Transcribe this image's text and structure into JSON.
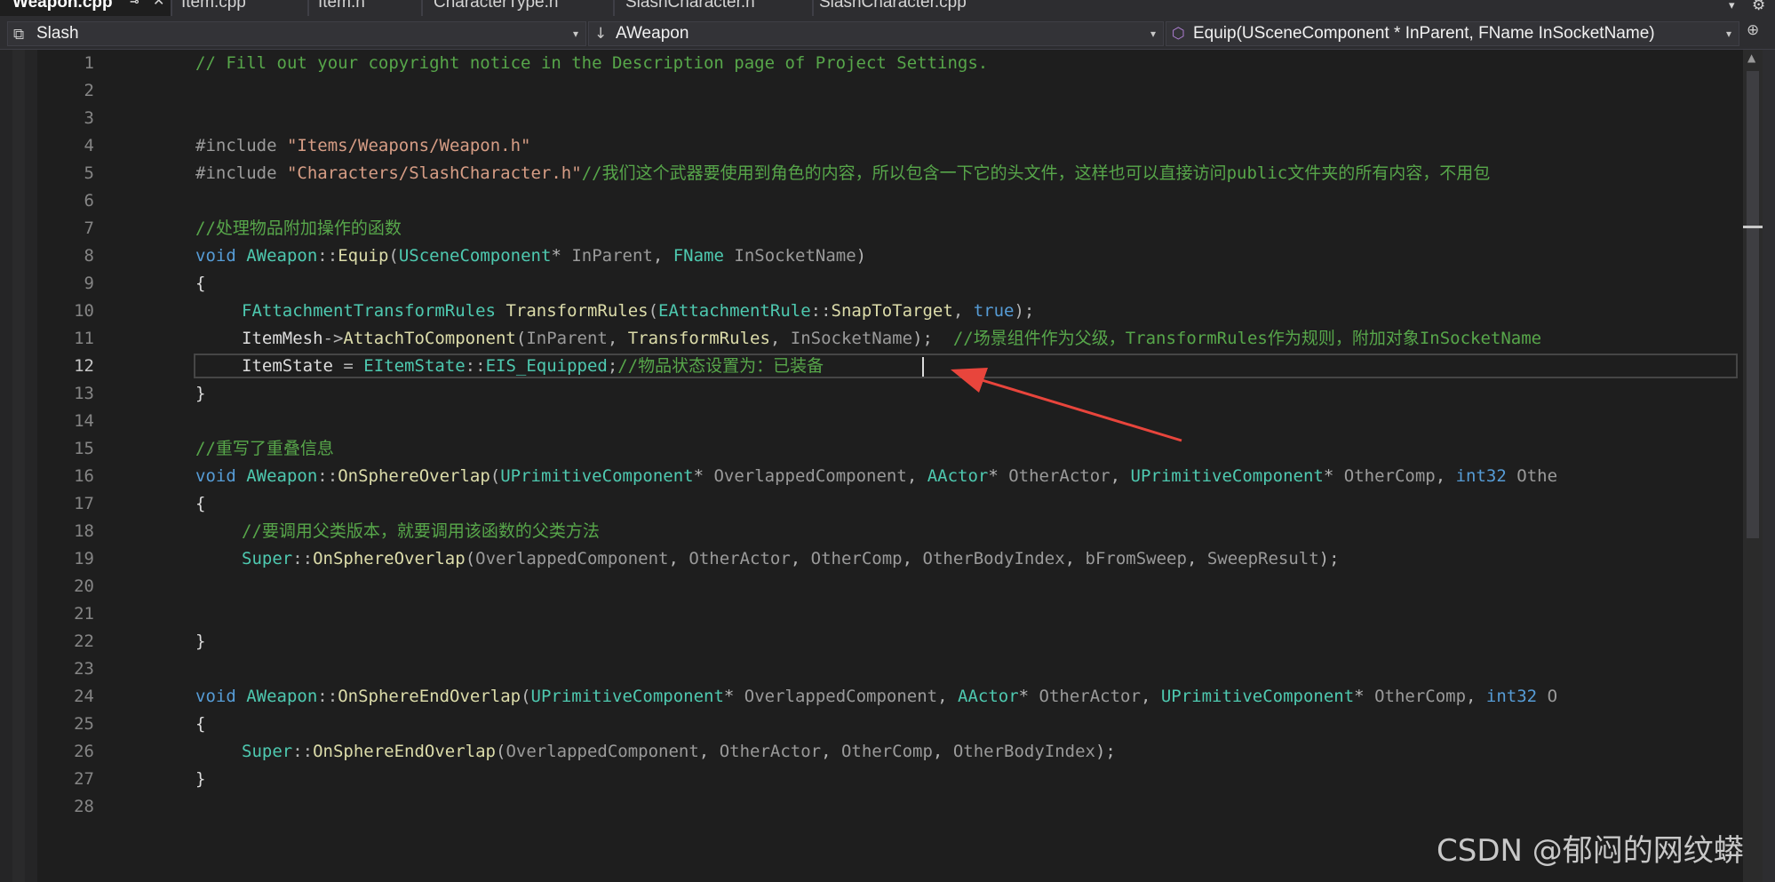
{
  "tabs": [
    {
      "label": "Weapon.cpp",
      "active": true
    },
    {
      "label": "Item.cpp"
    },
    {
      "label": "Item.h"
    },
    {
      "label": "CharacterType.h"
    },
    {
      "label": "SlashCharacter.h"
    },
    {
      "label": "SlashCharacter.cpp"
    }
  ],
  "tab_icons": {
    "pin": "pin-icon",
    "close": "✕",
    "overflow": "▾",
    "settings": "⚙"
  },
  "nav": {
    "project": "Slash",
    "scope": "AWeapon",
    "member": "Equip(USceneComponent * InParent, FName InSocketName)"
  },
  "line_numbers": [
    "1",
    "2",
    "3",
    "4",
    "5",
    "6",
    "7",
    "8",
    "9",
    "10",
    "11",
    "12",
    "13",
    "14",
    "15",
    "16",
    "17",
    "18",
    "19",
    "20",
    "21",
    "22",
    "23",
    "24",
    "25",
    "26",
    "27",
    "28"
  ],
  "current_line": "12",
  "code": {
    "l1": "// Fill out your copyright notice in the Description page of Project Settings.",
    "l4_dir": "#include ",
    "l4_str": "\"Items/Weapons/Weapon.h\"",
    "l5_dir": "#include ",
    "l5_str": "\"Characters/SlashCharacter.h\"",
    "l5_cm": "//我们这个武器要使用到角色的内容，所以包含一下它的头文件，这样也可以直接访问public文件夹的所有内容，不用包",
    "l7": "//处理物品附加操作的函数",
    "l8": [
      "void",
      "AWeapon",
      "::",
      "Equip",
      "(",
      "USceneComponent",
      "* ",
      "InParent",
      ", ",
      "FName",
      " ",
      "InSocketName",
      ")"
    ],
    "l9": "{",
    "l10": [
      "FAttachmentTransformRules",
      " ",
      "TransformRules",
      "(",
      "EAttachmentRule",
      "::",
      "SnapToTarget",
      ", ",
      "true",
      ");"
    ],
    "l11": [
      "ItemMesh",
      "->",
      "AttachToComponent",
      "(",
      "InParent",
      ", ",
      "TransformRules",
      ", ",
      "InSocketName",
      ");  ",
      "//场景组件作为父级，TransformRules作为规则，附加对象InSocketName"
    ],
    "l12": [
      "ItemState",
      " = ",
      "EItemState",
      "::",
      "EIS_Equipped",
      ";",
      "//物品状态设置为：已装备"
    ],
    "l13": "}",
    "l15": "//重写了重叠信息",
    "l16": [
      "void",
      "AWeapon",
      "::",
      "OnSphereOverlap",
      "(",
      "UPrimitiveComponent",
      "* ",
      "OverlappedComponent",
      ", ",
      "AActor",
      "* ",
      "OtherActor",
      ", ",
      "UPrimitiveComponent",
      "* ",
      "OtherComp",
      ", ",
      "int32",
      " ",
      "Othe"
    ],
    "l17": "{",
    "l18": "//要调用父类版本，就要调用该函数的父类方法",
    "l19": [
      "Super",
      "::",
      "OnSphereOverlap",
      "(",
      "OverlappedComponent",
      ", ",
      "OtherActor",
      ", ",
      "OtherComp",
      ", ",
      "OtherBodyIndex",
      ", ",
      "bFromSweep",
      ", ",
      "SweepResult",
      ");"
    ],
    "l22": "}",
    "l24": [
      "void",
      "AWeapon",
      "::",
      "OnSphereEndOverlap",
      "(",
      "UPrimitiveComponent",
      "* ",
      "OverlappedComponent",
      ", ",
      "AActor",
      "* ",
      "OtherActor",
      ", ",
      "UPrimitiveComponent",
      "* ",
      "OtherComp",
      ", ",
      "int32",
      " ",
      "O"
    ],
    "l25": "{",
    "l26": [
      "Super",
      "::",
      "OnSphereEndOverlap",
      "(",
      "OverlappedComponent",
      ", ",
      "OtherActor",
      ", ",
      "OtherComp",
      ", ",
      "OtherBodyIndex",
      ");"
    ],
    "l27": "}"
  },
  "colors": {
    "comment": "#57a64a",
    "keyword": "#569cd6",
    "type": "#4ec9b0",
    "function": "#dcdcaa",
    "string": "#d69d85",
    "annotation_arrow": "#e8453c"
  },
  "watermark": "CSDN @郁闷的网纹蟒"
}
